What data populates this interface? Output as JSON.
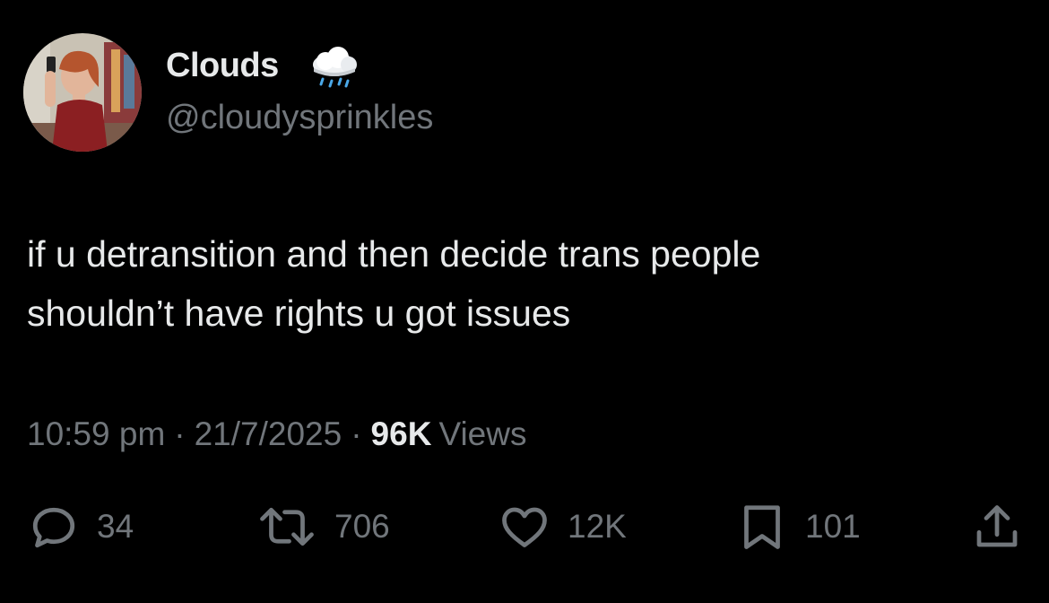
{
  "colors": {
    "background": "#000000",
    "primary_text": "#e7e9ea",
    "secondary_text": "#71767b"
  },
  "author": {
    "display_name": "Clouds",
    "name_emoji_icon": "cloud-with-rain-icon",
    "handle": "@cloudysprinkles",
    "avatar_icon": "profile-photo-avatar"
  },
  "tweet": {
    "lines": [
      "if u detransition and then decide trans people",
      "shouldn’t have rights u got issues"
    ]
  },
  "meta": {
    "time": "10:59 pm",
    "separator": "·",
    "date": "21/7/2025",
    "views_count": "96K",
    "views_label": "Views"
  },
  "actions": {
    "reply": {
      "icon": "reply-icon",
      "count": "34"
    },
    "retweet": {
      "icon": "retweet-icon",
      "count": "706"
    },
    "like": {
      "icon": "heart-icon",
      "count": "12K"
    },
    "bookmark": {
      "icon": "bookmark-icon",
      "count": "101"
    },
    "share": {
      "icon": "share-icon"
    }
  }
}
